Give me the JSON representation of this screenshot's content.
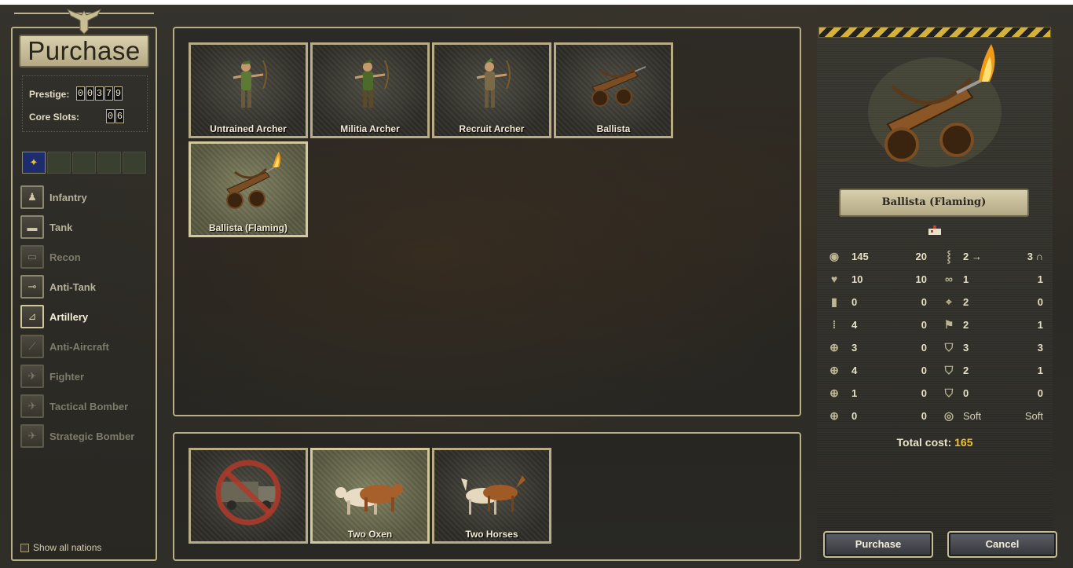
{
  "title": "Purchase",
  "prestige": {
    "label": "Prestige:",
    "digits": [
      "0",
      "0",
      "3",
      "7",
      "9"
    ]
  },
  "core_slots": {
    "label": "Core Slots:",
    "digits": [
      "0",
      "6"
    ]
  },
  "categories": [
    {
      "label": "Infantry",
      "icon": "infantry-icon",
      "state": "normal"
    },
    {
      "label": "Tank",
      "icon": "tank-icon",
      "state": "normal"
    },
    {
      "label": "Recon",
      "icon": "recon-icon",
      "state": "dim"
    },
    {
      "label": "Anti-Tank",
      "icon": "anti-tank-icon",
      "state": "normal"
    },
    {
      "label": "Artillery",
      "icon": "artillery-icon",
      "state": "active"
    },
    {
      "label": "Anti-Aircraft",
      "icon": "anti-aircraft-icon",
      "state": "dim"
    },
    {
      "label": "Fighter",
      "icon": "fighter-icon",
      "state": "dim"
    },
    {
      "label": "Tactical Bomber",
      "icon": "tactical-bomber-icon",
      "state": "dim"
    },
    {
      "label": "Strategic Bomber",
      "icon": "strategic-bomber-icon",
      "state": "dim"
    }
  ],
  "show_all_nations": "Show all nations",
  "units": [
    {
      "label": "Untrained Archer",
      "art": "archer",
      "selected": false
    },
    {
      "label": "Militia Archer",
      "art": "archer",
      "selected": false
    },
    {
      "label": "Recruit Archer",
      "art": "archer",
      "selected": false
    },
    {
      "label": "Ballista",
      "art": "ballista",
      "selected": false
    },
    {
      "label": "Ballista (Flaming)",
      "art": "ballista-flaming",
      "selected": true
    }
  ],
  "transports": [
    {
      "label": "",
      "art": "no-transport",
      "selected": false
    },
    {
      "label": "Two Oxen",
      "art": "oxen",
      "selected": true
    },
    {
      "label": "Two Horses",
      "art": "horses",
      "selected": false
    }
  ],
  "selected_unit": {
    "name": "Ballista (Flaming)"
  },
  "stats": [
    {
      "icon1": "coins-icon",
      "v1": "145",
      "v2": "20",
      "icon2": "footsteps-icon",
      "v3": "2 →",
      "v4": "3 ∩"
    },
    {
      "icon1": "heart-icon",
      "v1": "10",
      "v2": "10",
      "icon2": "binoculars-icon",
      "v3": "1",
      "v4": "1"
    },
    {
      "icon1": "fuel-icon",
      "v1": "0",
      "v2": "0",
      "icon2": "crosshair-icon",
      "v3": "2",
      "v4": "0"
    },
    {
      "icon1": "ammo-icon",
      "v1": "4",
      "v2": "0",
      "icon2": "initiative-icon",
      "v3": "2",
      "v4": "1"
    },
    {
      "icon1": "soft-attack-icon",
      "v1": "3",
      "v2": "0",
      "icon2": "hard-defense-icon",
      "v3": "3",
      "v4": "3"
    },
    {
      "icon1": "hard-attack-icon",
      "v1": "4",
      "v2": "0",
      "icon2": "air-defense-icon",
      "v3": "2",
      "v4": "1"
    },
    {
      "icon1": "air-attack-icon",
      "v1": "1",
      "v2": "0",
      "icon2": "close-defense-icon",
      "v3": "0",
      "v4": "0"
    },
    {
      "icon1": "naval-attack-icon",
      "v1": "0",
      "v2": "0",
      "icon2": "target-type-icon",
      "v3": "Soft",
      "v4": "Soft"
    }
  ],
  "total_cost": {
    "label": "Total cost:",
    "value": "165"
  },
  "buttons": {
    "purchase": "Purchase",
    "cancel": "Cancel"
  },
  "colors": {
    "accent_gold": "#f0c23a",
    "frame": "#b9ad86",
    "selected_card": "#6b6c50"
  }
}
